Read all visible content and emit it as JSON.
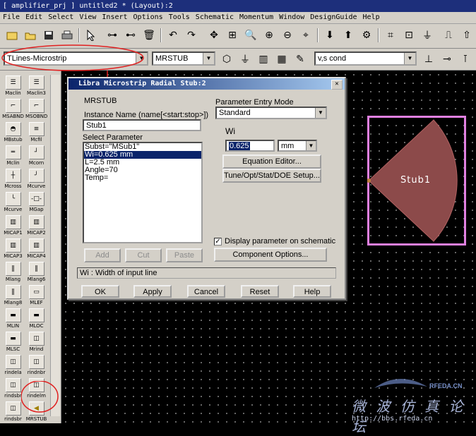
{
  "window": {
    "title": "[ amplifier_prj ] untitled2 * (Layout):2"
  },
  "menu": [
    "File",
    "Edit",
    "Select",
    "View",
    "Insert",
    "Options",
    "Tools",
    "Schematic",
    "Momentum",
    "Window",
    "DesignGuide",
    "Help"
  ],
  "toolbar2": {
    "palette_value": "TLines-Microstrip",
    "component_value": "MRSTUB",
    "layer_value": "v,s cond"
  },
  "palette": {
    "items": [
      "Maclin",
      "Maclin3",
      "MSABND",
      "MSOBND",
      "MBstub",
      "Mcfil",
      "Mclin",
      "Mcorn",
      "Mcross",
      "Mcurve",
      "Mcurve",
      "MGap",
      "MICAP1",
      "MICAP2",
      "MICAP3",
      "MICAP4",
      "Mlang",
      "Mlang6",
      "Mlang8",
      "MLEF",
      "MLIN",
      "MLOC",
      "MLSC",
      "Mrind",
      "rindela",
      "rindnbr",
      "rindsbr",
      "rindelm",
      "rindsbr",
      "MRSTUB"
    ]
  },
  "dialog": {
    "title": "Libra Microstrip Radial Stub:2",
    "component_name": "MRSTUB",
    "instance_label": "Instance Name  (name[<start:stop>])",
    "instance_value": "Stub1",
    "select_param_label": "Select Parameter",
    "params": [
      "Subst=\"MSub1\"",
      "Wi=0.625 mm",
      "L=2.5 mm",
      "Angle=70",
      "Temp="
    ],
    "selected_index": 1,
    "add_label": "Add",
    "cut_label": "Cut",
    "paste_label": "Paste",
    "entry_mode_label": "Parameter Entry Mode",
    "entry_mode_value": "Standard",
    "param_name": "Wi",
    "param_value": "0.625",
    "unit_value": "mm",
    "equation_editor": "Equation Editor...",
    "tune_setup": "Tune/Opt/Stat/DOE Setup...",
    "display_param_label": "Display parameter on schematic",
    "component_options": "Component Options...",
    "status": "Wi : Width of input line",
    "ok": "OK",
    "apply": "Apply",
    "cancel": "Cancel",
    "reset": "Reset",
    "help": "Help"
  },
  "layout": {
    "stub_label": "Stub1"
  },
  "watermark": {
    "top": "RFEDA.CN",
    "cn": "微 波 仿 真 论 坛",
    "url": "http://bbs.rfeda.cn"
  },
  "colors": {
    "stub_fill": "#8c4a4a",
    "stub_frame": "#e080e0",
    "title_bar": "#1d2f7b",
    "annotation": "#e02020"
  }
}
